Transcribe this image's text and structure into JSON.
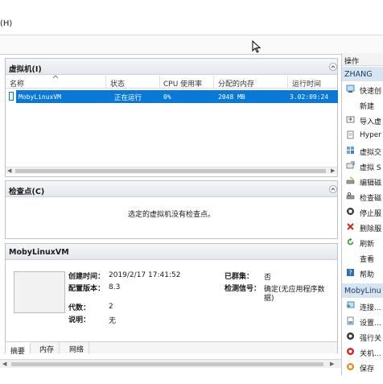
{
  "menubar": {
    "partial_menu": "(H)"
  },
  "vm_panel": {
    "title": "虚拟机(I)",
    "columns": [
      "名称",
      "状态",
      "CPU 使用率",
      "分配的内存",
      "运行时间"
    ],
    "rows": [
      {
        "name": "MobyLinuxVM",
        "state": "正在运行",
        "cpu": "0%",
        "memory": "2048 MB",
        "uptime": "3.02:09:24"
      }
    ]
  },
  "checkpoint_panel": {
    "title": "检查点(C)",
    "empty_message": "选定的虚拟机没有检查点。"
  },
  "detail_panel": {
    "title": "MobyLinuxVM",
    "created_label": "创建时间：",
    "created_value": "2019/2/17 17:41:52",
    "config_label": "配置版本：",
    "config_value": "8.3",
    "generation_label": "代数：",
    "generation_value": "2",
    "notes_label": "说明：",
    "notes_value": "无",
    "clustered_label": "已群集：",
    "clustered_value": "否",
    "heartbeat_label": "检测信号：",
    "heartbeat_value_1": "确定(无应用程序数",
    "heartbeat_value_2": "据)",
    "tabs": [
      "摘要",
      "内存",
      "网络"
    ]
  },
  "actions": {
    "header": "操作",
    "host_group": "ZHANG",
    "host_items": [
      {
        "label": "快速创",
        "icon": "quick-create-icon"
      },
      {
        "label": "新建",
        "icon": "new-icon"
      },
      {
        "label": "导入虚",
        "icon": "import-icon"
      },
      {
        "label": "Hyper",
        "icon": "hyperv-settings-icon"
      },
      {
        "label": "虚拟交",
        "icon": "virtual-switch-icon"
      },
      {
        "label": "虚拟 S",
        "icon": "virtual-san-icon"
      },
      {
        "label": "编辑磁",
        "icon": "edit-disk-icon"
      },
      {
        "label": "检查磁",
        "icon": "inspect-disk-icon"
      },
      {
        "label": "停止服",
        "icon": "stop-service-icon"
      },
      {
        "label": "删除服",
        "icon": "remove-server-icon"
      },
      {
        "label": "刷新",
        "icon": "refresh-icon"
      },
      {
        "label": "查看",
        "icon": "view-icon"
      },
      {
        "label": "帮助",
        "icon": "help-icon"
      }
    ],
    "vm_group": "MobyLinu",
    "vm_items": [
      {
        "label": "连接...",
        "icon": "connect-icon"
      },
      {
        "label": "设置...",
        "icon": "settings-icon"
      },
      {
        "label": "强行关",
        "icon": "turn-off-icon"
      },
      {
        "label": "关机...",
        "icon": "shutdown-icon"
      },
      {
        "label": "保存",
        "icon": "save-icon"
      }
    ]
  },
  "colors": {
    "selection": "#0a78d7",
    "group_bg": "#d7e4f2",
    "panel_border": "#bfc3c7"
  }
}
